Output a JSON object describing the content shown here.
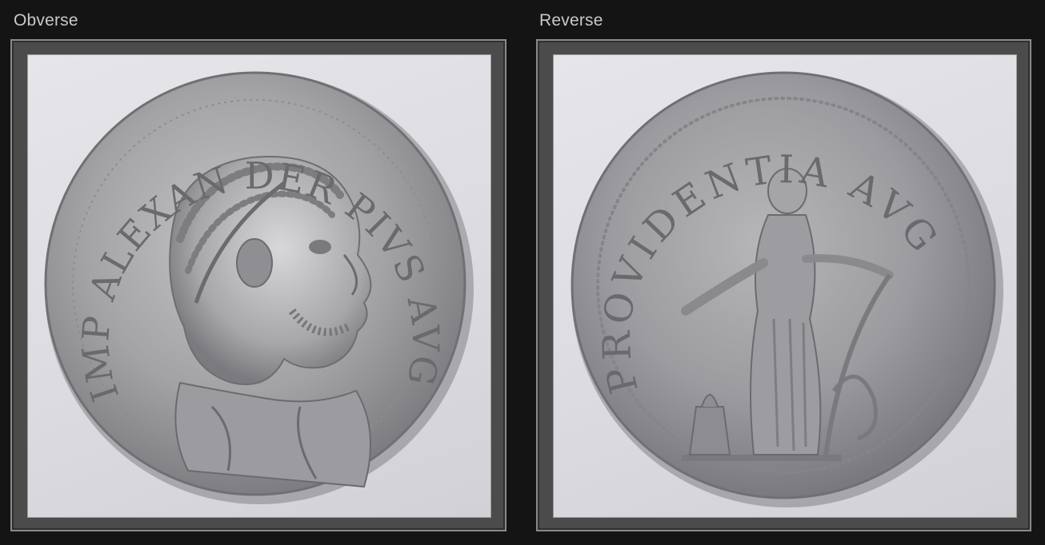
{
  "panels": [
    {
      "label": "Obverse",
      "image": {
        "subject": "coin-obverse-laureate-head-right",
        "legend": "IMP ALEXAN DER PIVS AVG"
      }
    },
    {
      "label": "Reverse",
      "image": {
        "subject": "coin-reverse-standing-figure-with-altar",
        "legend": "PROVIDENTIA AVG"
      }
    }
  ],
  "colors": {
    "page_background": "#141414",
    "frame": "#4b4b4b",
    "label_text": "#c9c9c9",
    "photo_background": "#e2e2e6",
    "silver": "#a9a9ab"
  }
}
